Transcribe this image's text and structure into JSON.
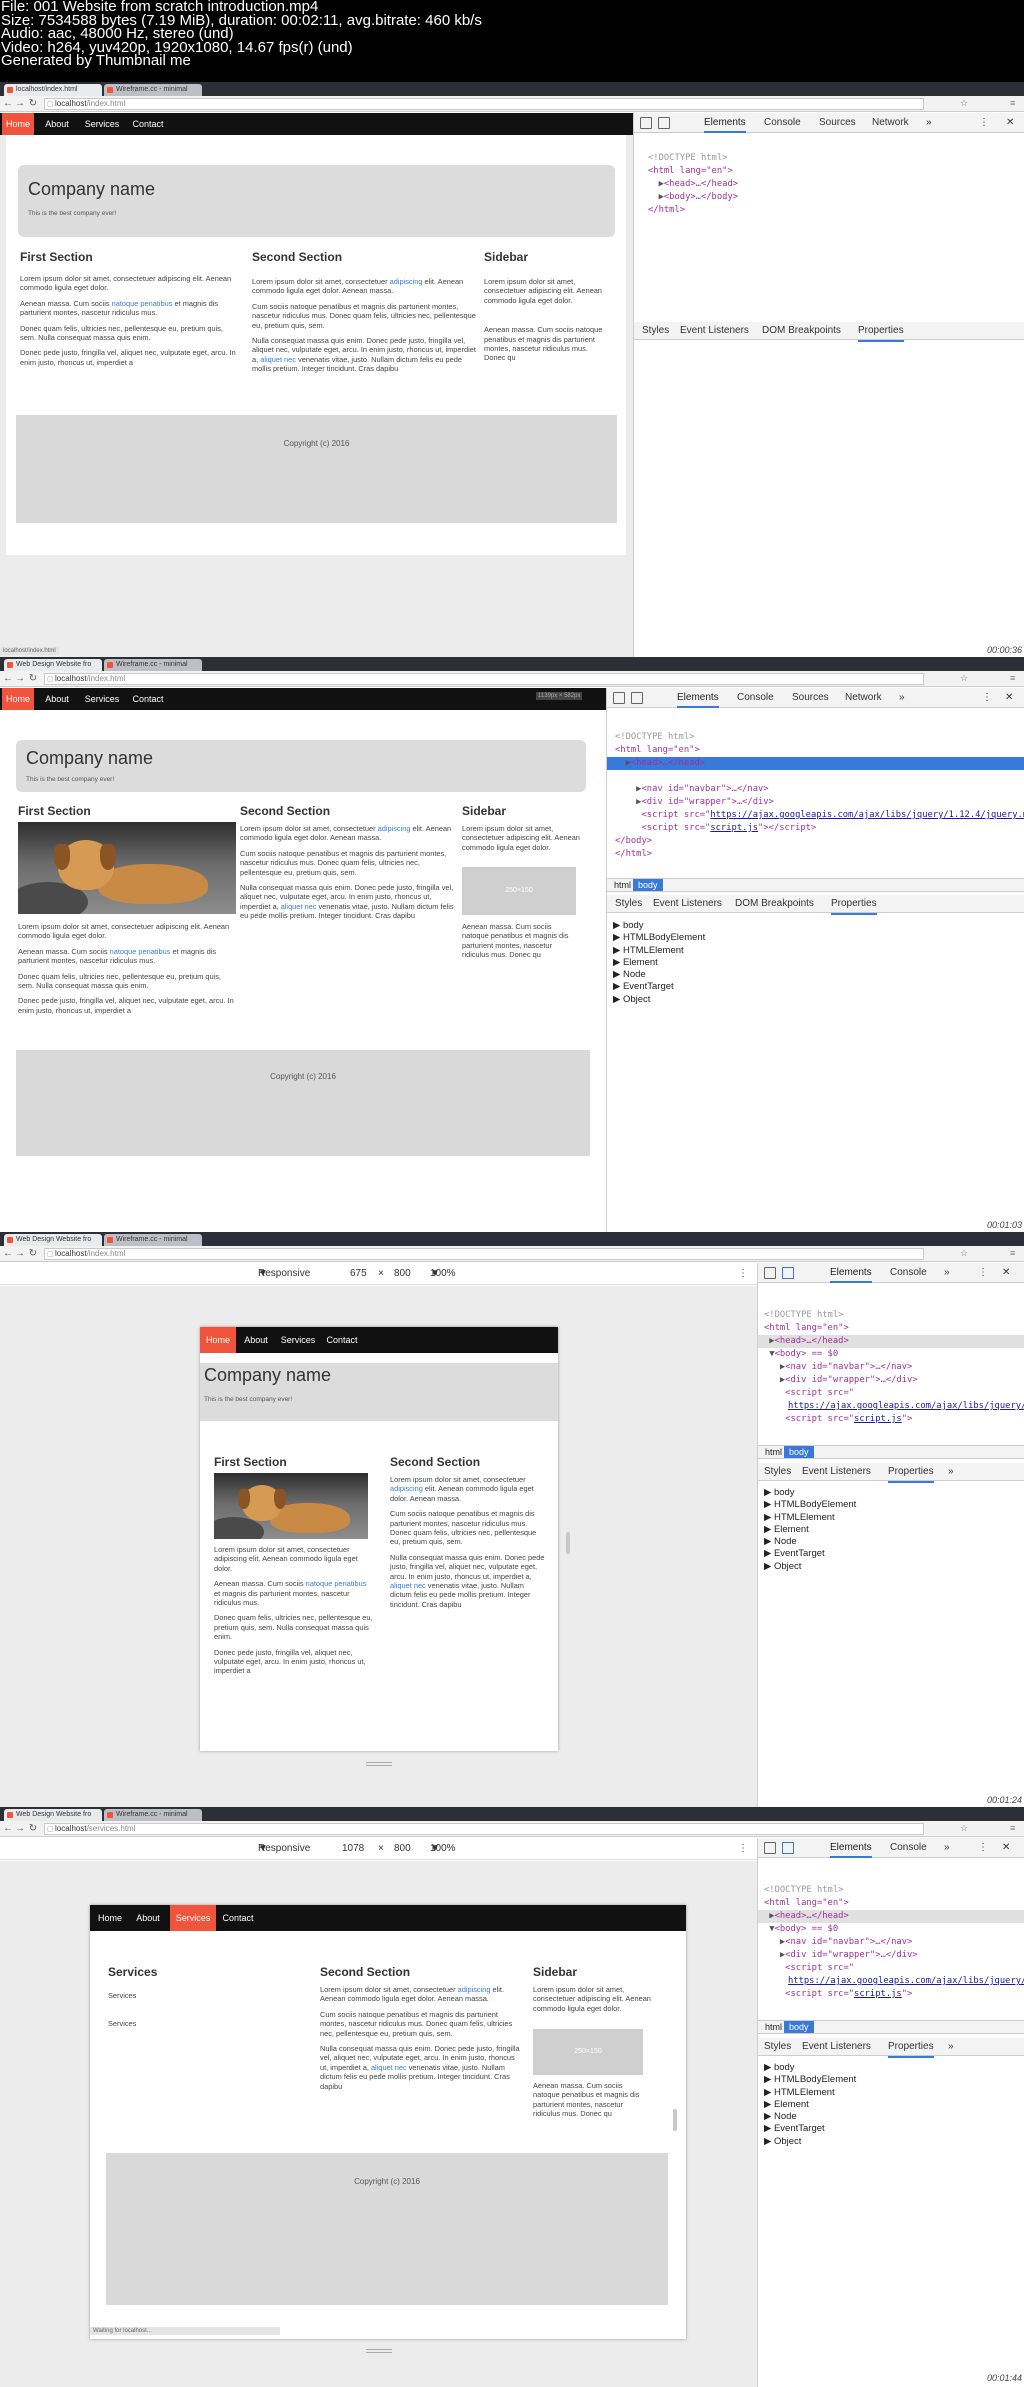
{
  "header": {
    "file": "File: 001 Website from scratch introduction.mp4",
    "size": "Size: 7534588 bytes (7.19 MiB), duration: 00:02:11, avg.bitrate: 460 kb/s",
    "audio": "Audio: aac, 48000 Hz, stereo (und)",
    "video": "Video: h264, yuv420p, 1920x1080, 14.67 fps(r) (und)",
    "generated": "Generated by Thumbnail me"
  },
  "browser": {
    "tab1": "localhost/index.html",
    "tab1_alt": "Web Design Website fro",
    "tab2": "Wireframe.cc - minimal",
    "host": "localhost",
    "path_index": "/index.html",
    "path_services": "/services.html"
  },
  "site": {
    "nav": [
      "Home",
      "About",
      "Services",
      "Contact"
    ],
    "company_name": "Company name",
    "tagline": "This is the best company ever!",
    "first_section": "First Section",
    "second_section": "Second Section",
    "sidebar": "Sidebar",
    "services_title": "Services",
    "services_link1": "Services",
    "services_link2": "Services",
    "footer": "Copyright (c) 2016",
    "placeholder": "250×150",
    "p1_a": "Lorem ipsum dolor sit amet, consectetuer adipiscing elit. Aenean commodo ligula eget dolor.",
    "p1_b1": "Aenean massa. Cum sociis ",
    "p1_b_link": "natoque penatibus",
    "p1_b2": " et magnis dis parturient montes, nascetur ridiculus mus.",
    "p1_c": "Donec quam felis, ultricies nec, pellentesque eu, pretium quis, sem. Nulla consequat massa quis enim.",
    "p1_d": "Donec pede justo, fringilla vel, aliquet nec, vulputate eget, arcu. In enim justo, rhoncus ut, imperdiet a",
    "p2_a1": "Lorem ipsum dolor sit amet, consectetuer ",
    "p2_a_link": "adipiscing",
    "p2_a2": " elit. Aenean commodo ligula eget dolor. Aenean massa.",
    "p2_b": "Cum sociis natoque penatibus et magnis dis parturient montes, nascetur ridiculus mus. Donec quam felis, ultricies nec, pellentesque eu, pretium quis, sem.",
    "p2_c1": "Nulla consequat massa quis enim. Donec pede justo, fringilla vel, aliquet nec, vulputate eget, arcu. In enim justo, rhoncus ut, imperdiet a, ",
    "p2_c_link": "aliquet nec",
    "p2_c2": " venenatis vitae, justo. Nullam dictum felis eu pede mollis pretium. Integer tincidunt. Cras dapibu",
    "p3_a": "Lorem ipsum dolor sit amet, consectetuer adipiscing elit. Aenean commodo ligula eget dolor.",
    "p3_b": "Aenean massa. Cum sociis natoque penatibus et magnis dis parturient montes, nascetur ridiculus mus. Donec qu"
  },
  "devtools": {
    "tabs": [
      "Elements",
      "Console",
      "Sources",
      "Network",
      "»"
    ],
    "tabs_short": [
      "Elements",
      "Console",
      "»"
    ],
    "pane_tabs": [
      "Styles",
      "Event Listeners",
      "DOM Breakpoints",
      "Properties"
    ],
    "pane_tabs_short": [
      "Styles",
      "Event Listeners",
      "Properties",
      "»"
    ],
    "props": [
      "body",
      "HTMLBodyElement",
      "HTMLElement",
      "Element",
      "Node",
      "EventTarget",
      "Object"
    ],
    "bc_html": "html",
    "bc_body": "body",
    "doctype": "<!DOCTYPE html>",
    "html_open": "<html lang=\"en\">",
    "head": "<head>…</head>",
    "body_collapsed": "<body>…</body>",
    "html_close": "</html>",
    "body_sel": "<body> == $0",
    "nav_el": "<nav id=\"navbar\">…</nav>",
    "div_el": "<div id=\"wrapper\">…</div>",
    "script_src": "https://ajax.googleapis.com/ajax/libs/jquery/1.12.4/jquery.min.js",
    "script_js": "script.js",
    "body_close": "</body>"
  },
  "responsive": {
    "mode": "Responsive",
    "w1": "675",
    "h1": "800",
    "w2": "1078",
    "h2": "800",
    "zoom": "100%",
    "x": "×"
  },
  "status": {
    "url": "localhost/index.html",
    "size_badge": "1139px × 582px",
    "waiting": "Waiting for localhost..."
  },
  "timestamps": [
    "00:00:36",
    "00:01:03",
    "00:01:24",
    "00:01:44"
  ]
}
